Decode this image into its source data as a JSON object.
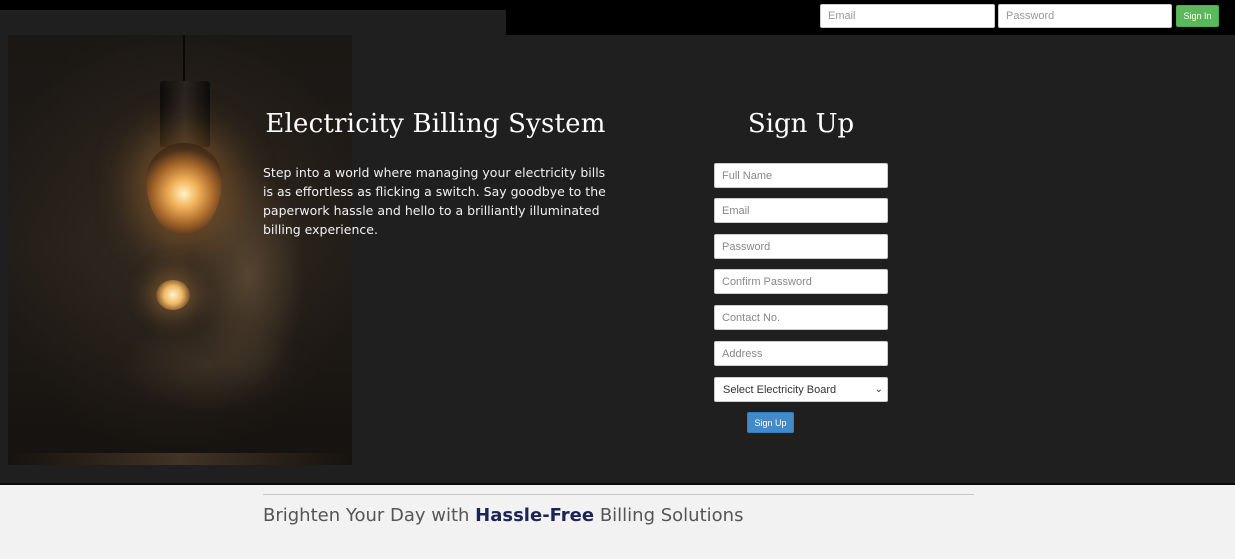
{
  "header": {
    "email_placeholder": "Email",
    "password_placeholder": "Password",
    "signin_label": "Sign In"
  },
  "hero": {
    "title": "Electricity Billing System",
    "description": "Step into a world where managing your electricity bills is as effortless as flicking a switch. Say goodbye to the paperwork hassle and hello to a brilliantly illuminated billing experience."
  },
  "signup": {
    "title": "Sign Up",
    "fields": {
      "full_name": "Full Name",
      "email": "Email",
      "password": "Password",
      "confirm_password": "Confirm Password",
      "contact": "Contact No.",
      "address": "Address"
    },
    "board_select": "Select Electricity Board",
    "button_label": "Sign Up"
  },
  "footer": {
    "tagline_before": "Brighten Your Day with ",
    "tagline_highlight": "Hassle-Free",
    "tagline_after": " Billing Solutions"
  },
  "colors": {
    "signin_button": "#5cb85c",
    "signup_button": "#428bca",
    "hero_background": "#1f1f1f",
    "tagline_highlight": "#1c2455"
  },
  "icons": {
    "select_arrow": "chevron-down-icon"
  }
}
